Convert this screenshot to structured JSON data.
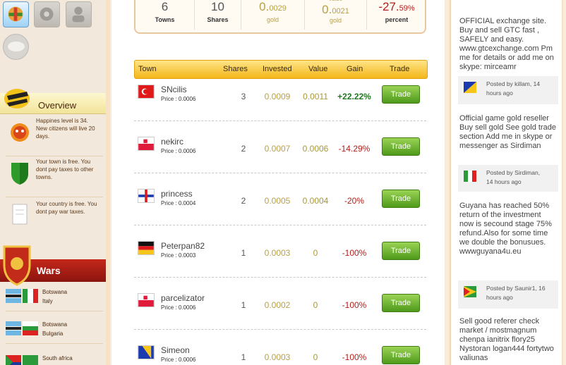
{
  "overview": {
    "title": "Overview",
    "items": [
      {
        "text": "Happines level is 34. New citizens will live 20 days."
      },
      {
        "text": "Your town is free. You dont pay taxes to other towns."
      },
      {
        "text": "Your country is free. You dont pay war taxes."
      }
    ]
  },
  "wars": {
    "title": "Wars",
    "items": [
      {
        "a": "Botswana",
        "b": "Italy"
      },
      {
        "a": "Botswana",
        "b": "Bulgaria"
      },
      {
        "a": "South africa",
        "b": ""
      }
    ]
  },
  "stats": {
    "towns": {
      "value": "6",
      "label": "Towns"
    },
    "shares": {
      "value": "10",
      "label": "Shares"
    },
    "gold1": {
      "value_big": "0.",
      "value_small": "0029",
      "label": "gold"
    },
    "gold2": {
      "top": "value",
      "value_big": "0.",
      "value_small": "0021",
      "label": "gold"
    },
    "percent": {
      "value_big": "-27.",
      "value_small": "59%",
      "label": "percent"
    }
  },
  "table": {
    "headers": {
      "town": "Town",
      "shares": "Shares",
      "invested": "Invested",
      "value": "Value",
      "gain": "Gain",
      "trade": "Trade"
    },
    "rows": [
      {
        "town": "SNcilis",
        "price": "Price : 0.0006",
        "shares": "3",
        "invested": "0.0009",
        "value": "0.0011",
        "gain": "+22.22%",
        "trade": "Trade"
      },
      {
        "town": "nekirc",
        "price": "Price : 0.0006",
        "shares": "2",
        "invested": "0.0007",
        "value": "0.0006",
        "gain": "-14.29%",
        "trade": "Trade"
      },
      {
        "town": "princess",
        "price": "Price : 0.0004",
        "shares": "2",
        "invested": "0.0005",
        "value": "0.0004",
        "gain": "-20%",
        "trade": "Trade"
      },
      {
        "town": "Peterpan82",
        "price": "Price : 0.0003",
        "shares": "1",
        "invested": "0.0003",
        "value": "0",
        "gain": "-100%",
        "trade": "Trade"
      },
      {
        "town": "parcelizator",
        "price": "Price : 0.0006",
        "shares": "1",
        "invested": "0.0002",
        "value": "0",
        "gain": "-100%",
        "trade": "Trade"
      },
      {
        "town": "Simeon",
        "price": "Price : 0.0006",
        "shares": "1",
        "invested": "0.0003",
        "value": "0",
        "gain": "-100%",
        "trade": "Trade"
      }
    ]
  },
  "feed": [
    {
      "text": "OFFICIAL exchange site. Buy and sell GTC fast , SAFELY and easy. www.gtcexchange.com Pm me for details or add me on skype: mirceamr",
      "meta1": "Posted by killam, 14",
      "meta2": "hours ago"
    },
    {
      "text": "Official game gold reseller Buy sell gold See gold trade section Add me in skype or messenger as Sirdiman",
      "meta1": "Posted by Sirdiman,",
      "meta2": "14 hours ago"
    },
    {
      "text": "Guyana has reached 50% return of the investment now is secound stage 75% refund.Also for some time we double the bonusues. wwwguyana4u.eu",
      "meta1": "Posted by Saunir1, 16",
      "meta2": "hours ago"
    },
    {
      "text": "Sell good referer check market / mostmagnum chenpa ianitrix flory25 Nystoran logan444 fortytwo valiunas",
      "meta1": "",
      "meta2": ""
    }
  ],
  "colors": {
    "accent": "#f3b619",
    "positive": "#1f7a1f",
    "negative": "#b0201a",
    "gold": "#b8a048",
    "button": "#5fa82a"
  }
}
